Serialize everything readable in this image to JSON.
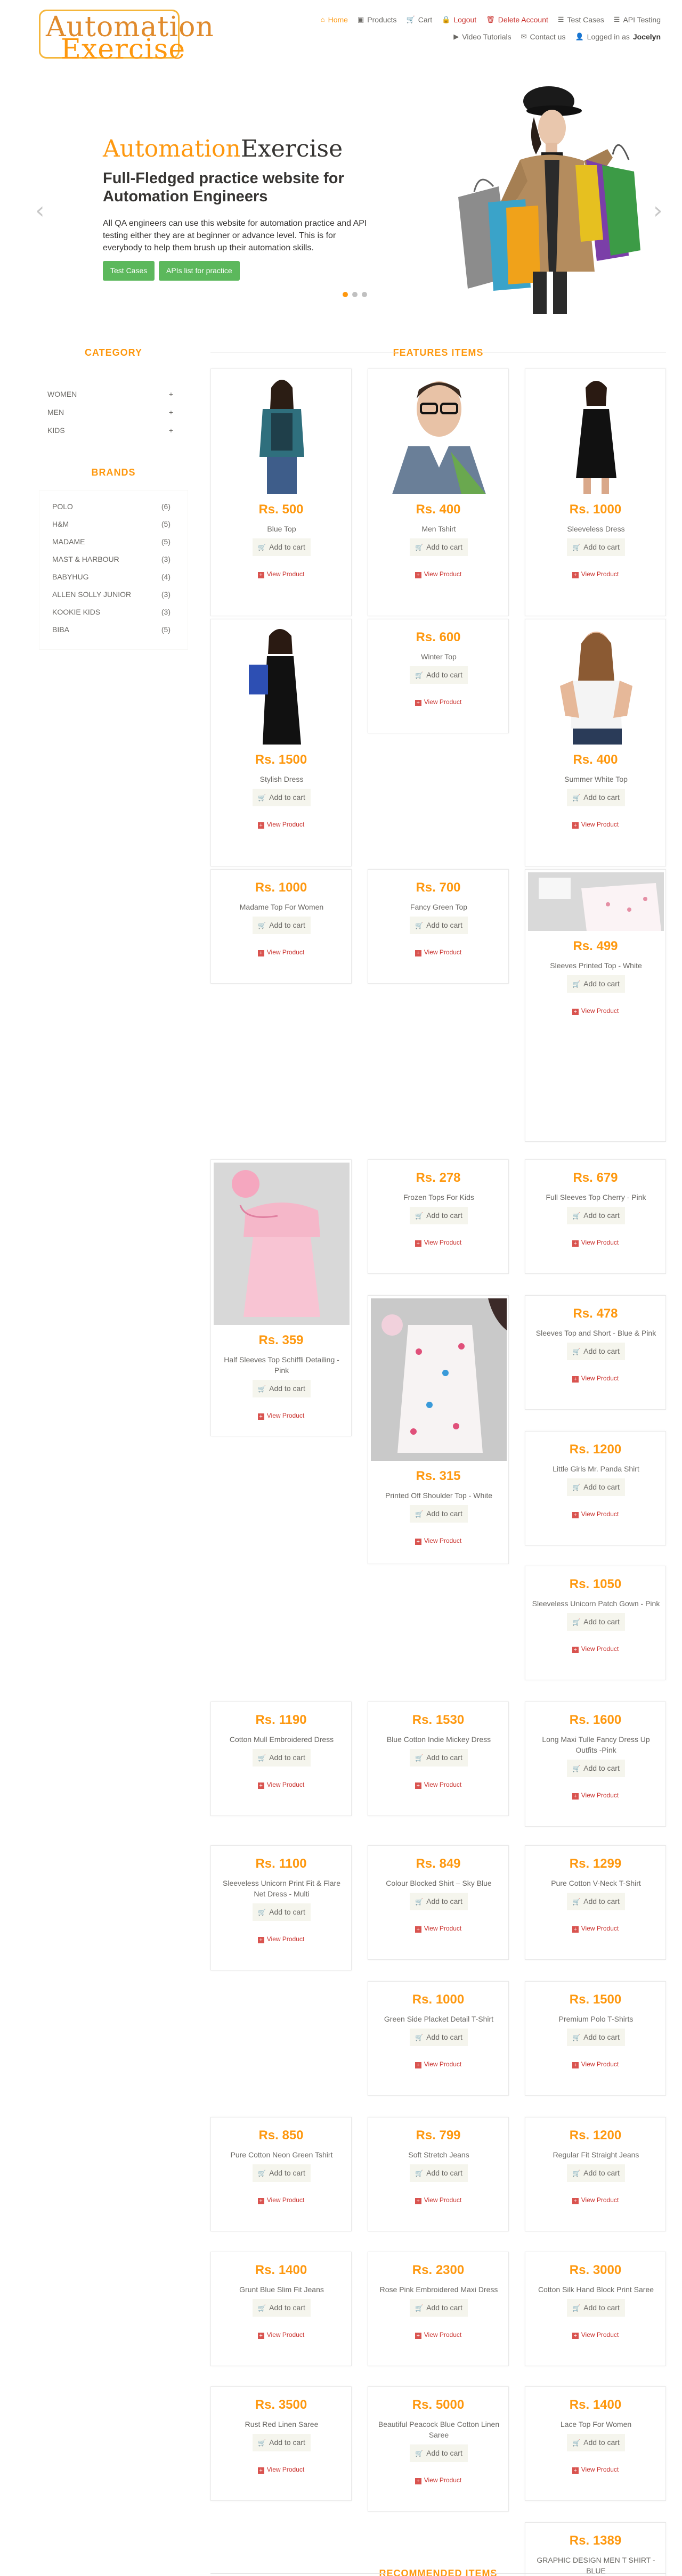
{
  "logo": {
    "part1": "Automation",
    "part2": "Exercise"
  },
  "nav": {
    "row1": [
      {
        "label": "Home",
        "icon": "home-icon",
        "glyph": "⌂",
        "style": "active"
      },
      {
        "label": "Products",
        "icon": "products-icon",
        "glyph": "▣",
        "style": ""
      },
      {
        "label": "Cart",
        "icon": "cart-icon",
        "glyph": "🛒",
        "style": ""
      },
      {
        "label": "Logout",
        "icon": "lock-icon",
        "glyph": "🔒",
        "style": "red"
      },
      {
        "label": "Delete Account",
        "icon": "trash-icon",
        "glyph": "🗑",
        "style": "red"
      },
      {
        "label": "Test Cases",
        "icon": "list-icon",
        "glyph": "☰",
        "style": ""
      },
      {
        "label": "API Testing",
        "icon": "list-icon",
        "glyph": "☰",
        "style": ""
      }
    ],
    "row2": [
      {
        "label": "Video Tutorials",
        "icon": "youtube-icon",
        "glyph": "▶",
        "style": ""
      },
      {
        "label": "Contact us",
        "icon": "envelope-icon",
        "glyph": "✉",
        "style": ""
      }
    ],
    "logged_in_prefix": "Logged in as",
    "logged_in_user": "Jocelyn"
  },
  "slider": {
    "title_orange": "Automation",
    "title_gray": "Exercise",
    "subtitle": "Full-Fledged practice website for Automation Engineers",
    "description": "All QA engineers can use this website for automation practice and API testing either they are at beginner or advance level. This is for everybody to help them brush up their automation skills.",
    "btn_test_cases": "Test Cases",
    "btn_apis": "APIs list for practice",
    "arrow_left": "‹",
    "arrow_right": "›",
    "active_dot": 0
  },
  "sidebar": {
    "category_title": "CATEGORY",
    "categories": [
      "WOMEN",
      "MEN",
      "KIDS"
    ],
    "plus": "+",
    "brands_title": "BRANDS",
    "brands": [
      {
        "name": "POLO",
        "count": "(6)"
      },
      {
        "name": "H&M",
        "count": "(5)"
      },
      {
        "name": "MADAME",
        "count": "(5)"
      },
      {
        "name": "MAST & HARBOUR",
        "count": "(3)"
      },
      {
        "name": "BABYHUG",
        "count": "(4)"
      },
      {
        "name": "ALLEN SOLLY JUNIOR",
        "count": "(3)"
      },
      {
        "name": "KOOKIE KIDS",
        "count": "(3)"
      },
      {
        "name": "BIBA",
        "count": "(5)"
      }
    ]
  },
  "features_title": "FEATURES ITEMS",
  "recommended_title": "RECOMMENDED ITEMS",
  "card_labels": {
    "add_to_cart": "Add to cart",
    "view_product": "View Product",
    "cart_glyph": "🛒",
    "plus_glyph": "+"
  },
  "products": [
    {
      "price": "Rs. 500",
      "name": "Blue Top"
    },
    {
      "price": "Rs. 400",
      "name": "Men Tshirt"
    },
    {
      "price": "Rs. 1000",
      "name": "Sleeveless Dress"
    },
    {
      "price": "Rs. 1500",
      "name": "Stylish Dress"
    },
    {
      "price": "Rs. 600",
      "name": "Winter Top"
    },
    {
      "price": "Rs. 400",
      "name": "Summer White Top"
    },
    {
      "price": "Rs. 1000",
      "name": "Madame Top For Women"
    },
    {
      "price": "Rs. 700",
      "name": "Fancy Green Top"
    },
    {
      "price": "Rs. 499",
      "name": "Sleeves Printed Top - White"
    },
    {
      "price": "Rs. 359",
      "name": "Half Sleeves Top Schiffli Detailing - Pink"
    },
    {
      "price": "Rs. 278",
      "name": "Frozen Tops For Kids"
    },
    {
      "price": "Rs. 679",
      "name": "Full Sleeves Top Cherry - Pink"
    },
    {
      "price": "Rs. 315",
      "name": "Printed Off Shoulder Top - White"
    },
    {
      "price": "Rs. 478",
      "name": "Sleeves Top and Short - Blue & Pink"
    },
    {
      "price": "Rs. 1200",
      "name": "Little Girls Mr. Panda Shirt"
    },
    {
      "price": "Rs. 1050",
      "name": "Sleeveless Unicorn Patch Gown - Pink"
    },
    {
      "price": "Rs. 1190",
      "name": "Cotton Mull Embroidered Dress"
    },
    {
      "price": "Rs. 1530",
      "name": "Blue Cotton Indie Mickey Dress"
    },
    {
      "price": "Rs. 1600",
      "name": "Long Maxi Tulle Fancy Dress Up Outfits -Pink"
    },
    {
      "price": "Rs. 1100",
      "name": "Sleeveless Unicorn Print Fit & Flare Net Dress - Multi"
    },
    {
      "price": "Rs. 849",
      "name": "Colour Blocked Shirt – Sky Blue"
    },
    {
      "price": "Rs. 1299",
      "name": "Pure Cotton V-Neck T-Shirt"
    },
    {
      "price": "Rs. 1000",
      "name": "Green Side Placket Detail T-Shirt"
    },
    {
      "price": "Rs. 1500",
      "name": "Premium Polo T-Shirts"
    },
    {
      "price": "Rs. 850",
      "name": "Pure Cotton Neon Green Tshirt"
    },
    {
      "price": "Rs. 799",
      "name": "Soft Stretch Jeans"
    },
    {
      "price": "Rs. 1200",
      "name": "Regular Fit Straight Jeans"
    },
    {
      "price": "Rs. 1400",
      "name": "Grunt Blue Slim Fit Jeans"
    },
    {
      "price": "Rs. 2300",
      "name": "Rose Pink Embroidered Maxi Dress"
    },
    {
      "price": "Rs. 3000",
      "name": "Cotton Silk Hand Block Print Saree"
    },
    {
      "price": "Rs. 3500",
      "name": "Rust Red Linen Saree"
    },
    {
      "price": "Rs. 5000",
      "name": "Beautiful Peacock Blue Cotton Linen Saree"
    },
    {
      "price": "Rs. 1400",
      "name": "Lace Top For Women"
    },
    {
      "price": "Rs. 1389",
      "name": "GRAPHIC DESIGN MEN T SHIRT - BLUE"
    }
  ],
  "colors": {
    "accent": "#FE980F",
    "green": "#5CB85C",
    "red": "#C9302C"
  }
}
